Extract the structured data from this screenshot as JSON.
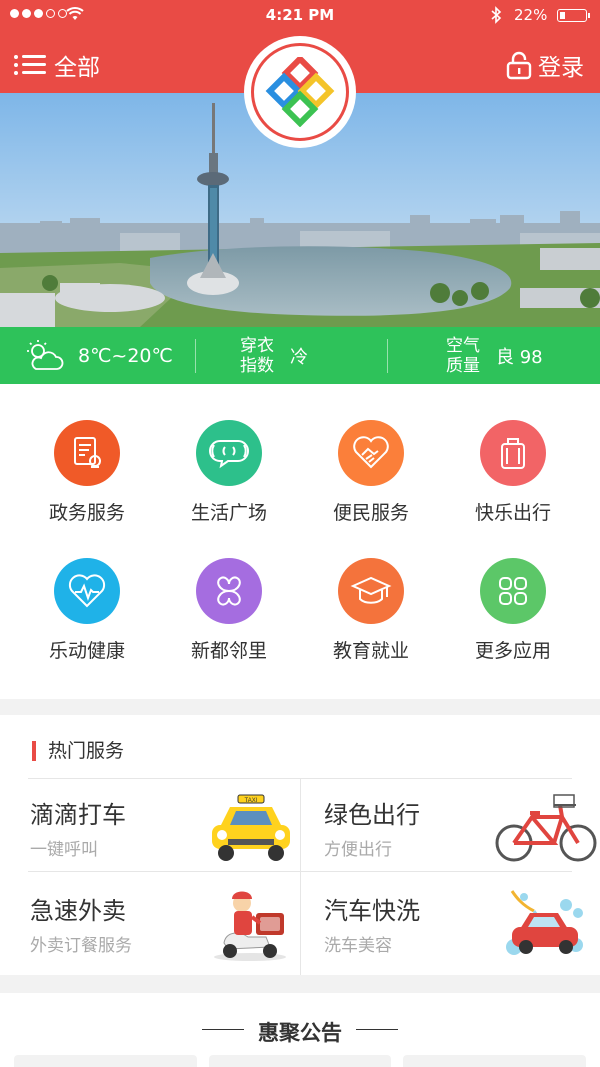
{
  "status_bar": {
    "time": "4:21 PM",
    "battery": "22%"
  },
  "nav": {
    "menu_label": "全部",
    "login_label": "登录"
  },
  "weather": {
    "temperature": "8℃~20℃",
    "clothing_label_1": "穿衣",
    "clothing_label_2": "指数",
    "clothing_value": "冷",
    "air_label_1": "空气",
    "air_label_2": "质量",
    "air_value": "良 98"
  },
  "services": [
    {
      "label": "政务服务",
      "color": "#f05a28",
      "icon": "document-seal-icon"
    },
    {
      "label": "生活广场",
      "color": "#2dc08b",
      "icon": "chat-waves-icon"
    },
    {
      "label": "便民服务",
      "color": "#fb7f3a",
      "icon": "handshake-heart-icon"
    },
    {
      "label": "快乐出行",
      "color": "#f26466",
      "icon": "suitcase-icon"
    },
    {
      "label": "乐动健康",
      "color": "#1fb2e8",
      "icon": "heart-pulse-icon"
    },
    {
      "label": "新都邻里",
      "color": "#a56de0",
      "icon": "clover-icon"
    },
    {
      "label": "教育就业",
      "color": "#f4733c",
      "icon": "graduation-cap-icon"
    },
    {
      "label": "更多应用",
      "color": "#5cc768",
      "icon": "grid-apps-icon"
    }
  ],
  "hot_services": {
    "title": "热门服务",
    "items": [
      {
        "name": "滴滴打车",
        "sub": "一键呼叫",
        "icon": "taxi-icon"
      },
      {
        "name": "绿色出行",
        "sub": "方便出行",
        "icon": "bicycle-icon"
      },
      {
        "name": "急速外卖",
        "sub": "外卖订餐服务",
        "icon": "delivery-scooter-icon"
      },
      {
        "name": "汽车快洗",
        "sub": "洗车美容",
        "icon": "car-wash-icon"
      }
    ]
  },
  "notice": {
    "title": "惠聚公告"
  },
  "colors": {
    "brand_red": "#e94b45",
    "weather_green": "#2ec25a"
  }
}
